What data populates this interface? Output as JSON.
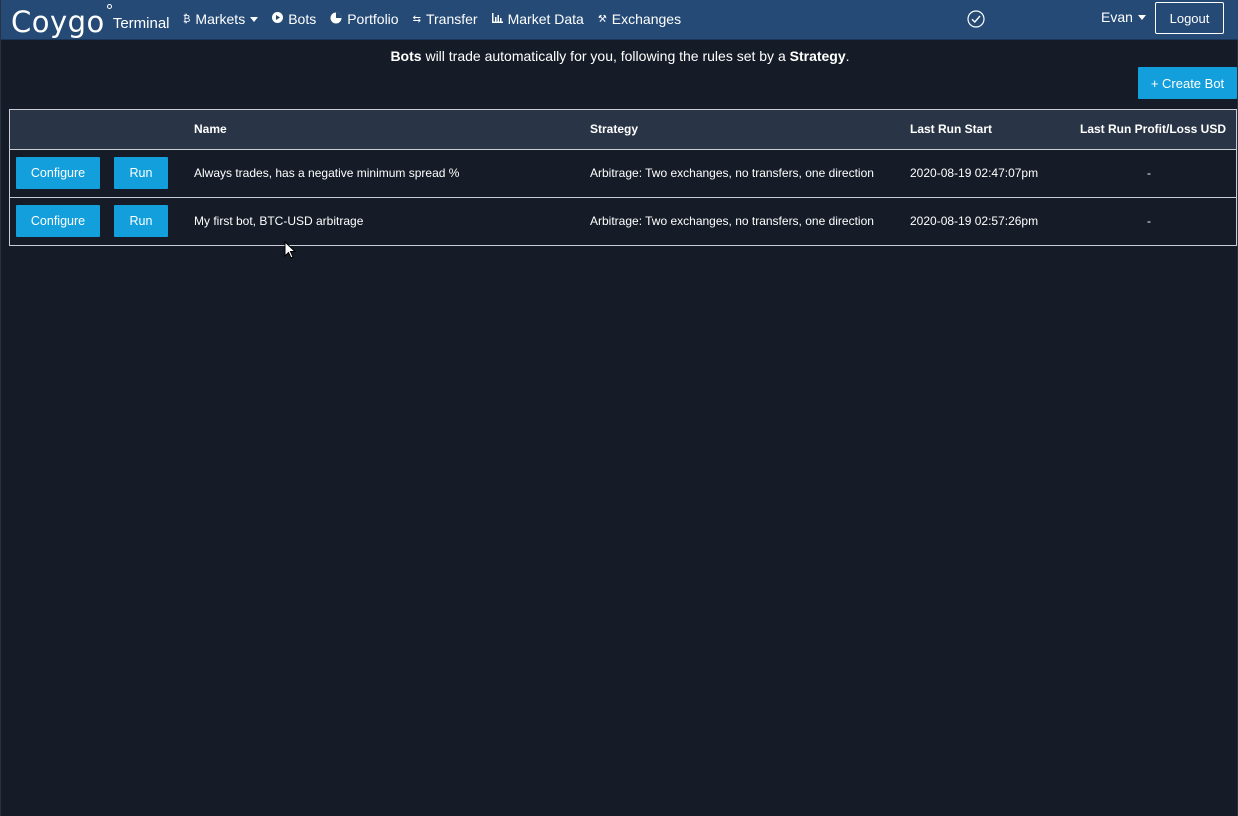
{
  "brand": {
    "logo": "Coygo",
    "subtitle": "Terminal"
  },
  "nav": {
    "items": [
      {
        "label": "Markets",
        "icon": "bitcoin-icon",
        "glyph": "₿",
        "has_caret": true
      },
      {
        "label": "Bots",
        "icon": "play-circle-icon",
        "glyph": "▶"
      },
      {
        "label": "Portfolio",
        "icon": "pie-chart-icon",
        "glyph": "◔"
      },
      {
        "label": "Transfer",
        "icon": "exchange-arrows-icon",
        "glyph": "⇆"
      },
      {
        "label": "Market Data",
        "icon": "bar-chart-icon",
        "glyph": "▥"
      },
      {
        "label": "Exchanges",
        "icon": "tools-icon",
        "glyph": "⚒"
      }
    ],
    "user": "Evan",
    "logout_label": "Logout"
  },
  "intro": {
    "bold1": "Bots",
    "text1": " will trade automatically for you, following the rules set by a ",
    "bold2": "Strategy",
    "text2": "."
  },
  "create_bot_label": "+ Create Bot",
  "table": {
    "headers": [
      "",
      "Name",
      "Strategy",
      "Last Run Start",
      "Last Run Profit/Loss USD"
    ],
    "configure_label": "Configure",
    "run_label": "Run",
    "rows": [
      {
        "name": "Always trades, has a negative minimum spread %",
        "strategy": "Arbitrage: Two exchanges, no transfers, one direction",
        "last_run_start": "2020-08-19 02:47:07pm",
        "profit_loss": "-"
      },
      {
        "name": "My first bot, BTC-USD arbitrage",
        "strategy": "Arbitrage: Two exchanges, no transfers, one direction",
        "last_run_start": "2020-08-19 02:57:26pm",
        "profit_loss": "-"
      }
    ]
  },
  "colors": {
    "navbar": "#244a75",
    "background": "#151c27",
    "table_header": "#293546",
    "accent_button": "#139fdc"
  }
}
